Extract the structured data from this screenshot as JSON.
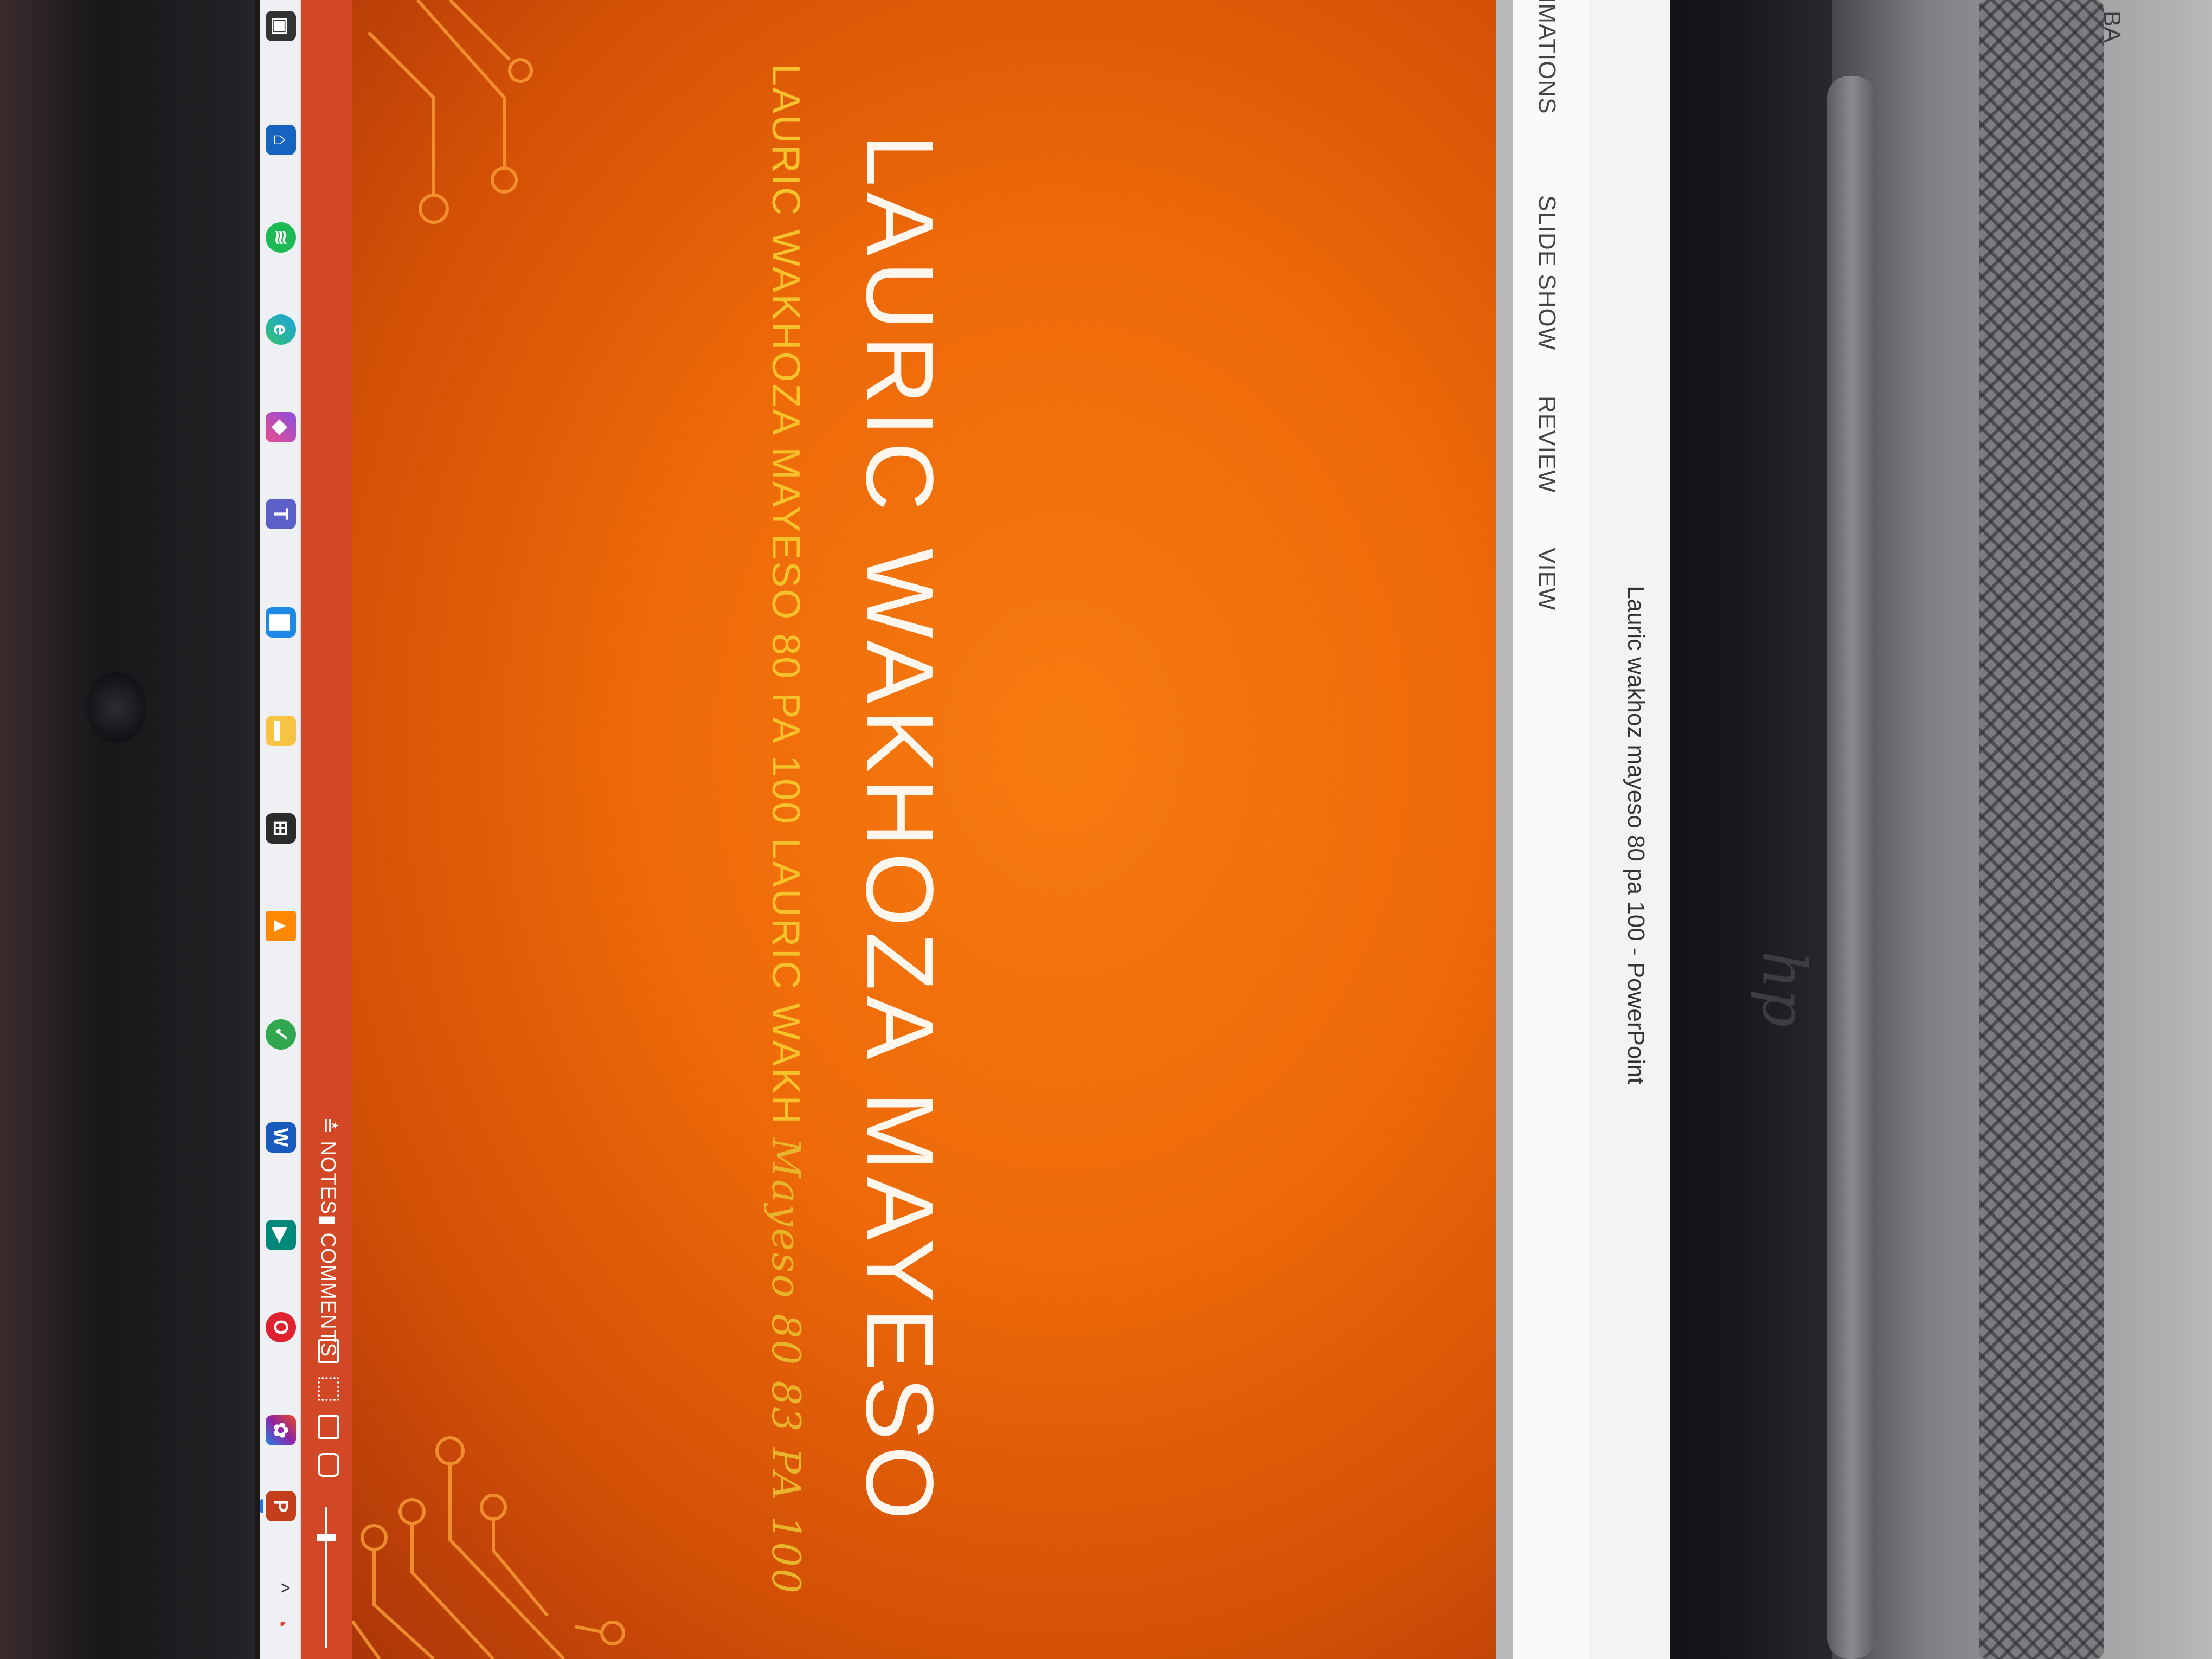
{
  "window": {
    "title": "Lauric wakhoz mayeso 80 pa 100  -  PowerPoint"
  },
  "ribbon": {
    "tabs": [
      "ANIMATIONS",
      "SLIDE SHOW",
      "REVIEW",
      "VIEW"
    ]
  },
  "slide": {
    "title": "LAURIC WAKHOZA MAYESO",
    "subtitle": "LAURIC WAKHOZA MAYESO 80 PA 100 LAURIC WAKH",
    "subtitle_handwritten": "Mayeso 80 83 PA 100",
    "background_color": "#ee6a09",
    "accent_color": "#f5c22c"
  },
  "statusbar": {
    "notes_label": "NOTES",
    "comments_label": "COMMENTS",
    "color": "#d24726"
  },
  "taskbar": {
    "icons": [
      "start-icon",
      "store-icon",
      "spotify-icon",
      "edge-icon",
      "copilot-icon",
      "teams-icon",
      "widget-icon",
      "file-explorer-icon",
      "microsoft-store-icon",
      "vlc-icon",
      "green-app-icon",
      "word-icon",
      "meet-icon",
      "opera-icon",
      "microsoft365-icon",
      "powerpoint-icon"
    ],
    "tray_icons": [
      "chevron-up-icon",
      "google-drive-icon",
      "airplane-icon",
      "wifi-icon",
      "battery-icon"
    ]
  },
  "device": {
    "brand": "hp",
    "chassis_text": "BA"
  }
}
